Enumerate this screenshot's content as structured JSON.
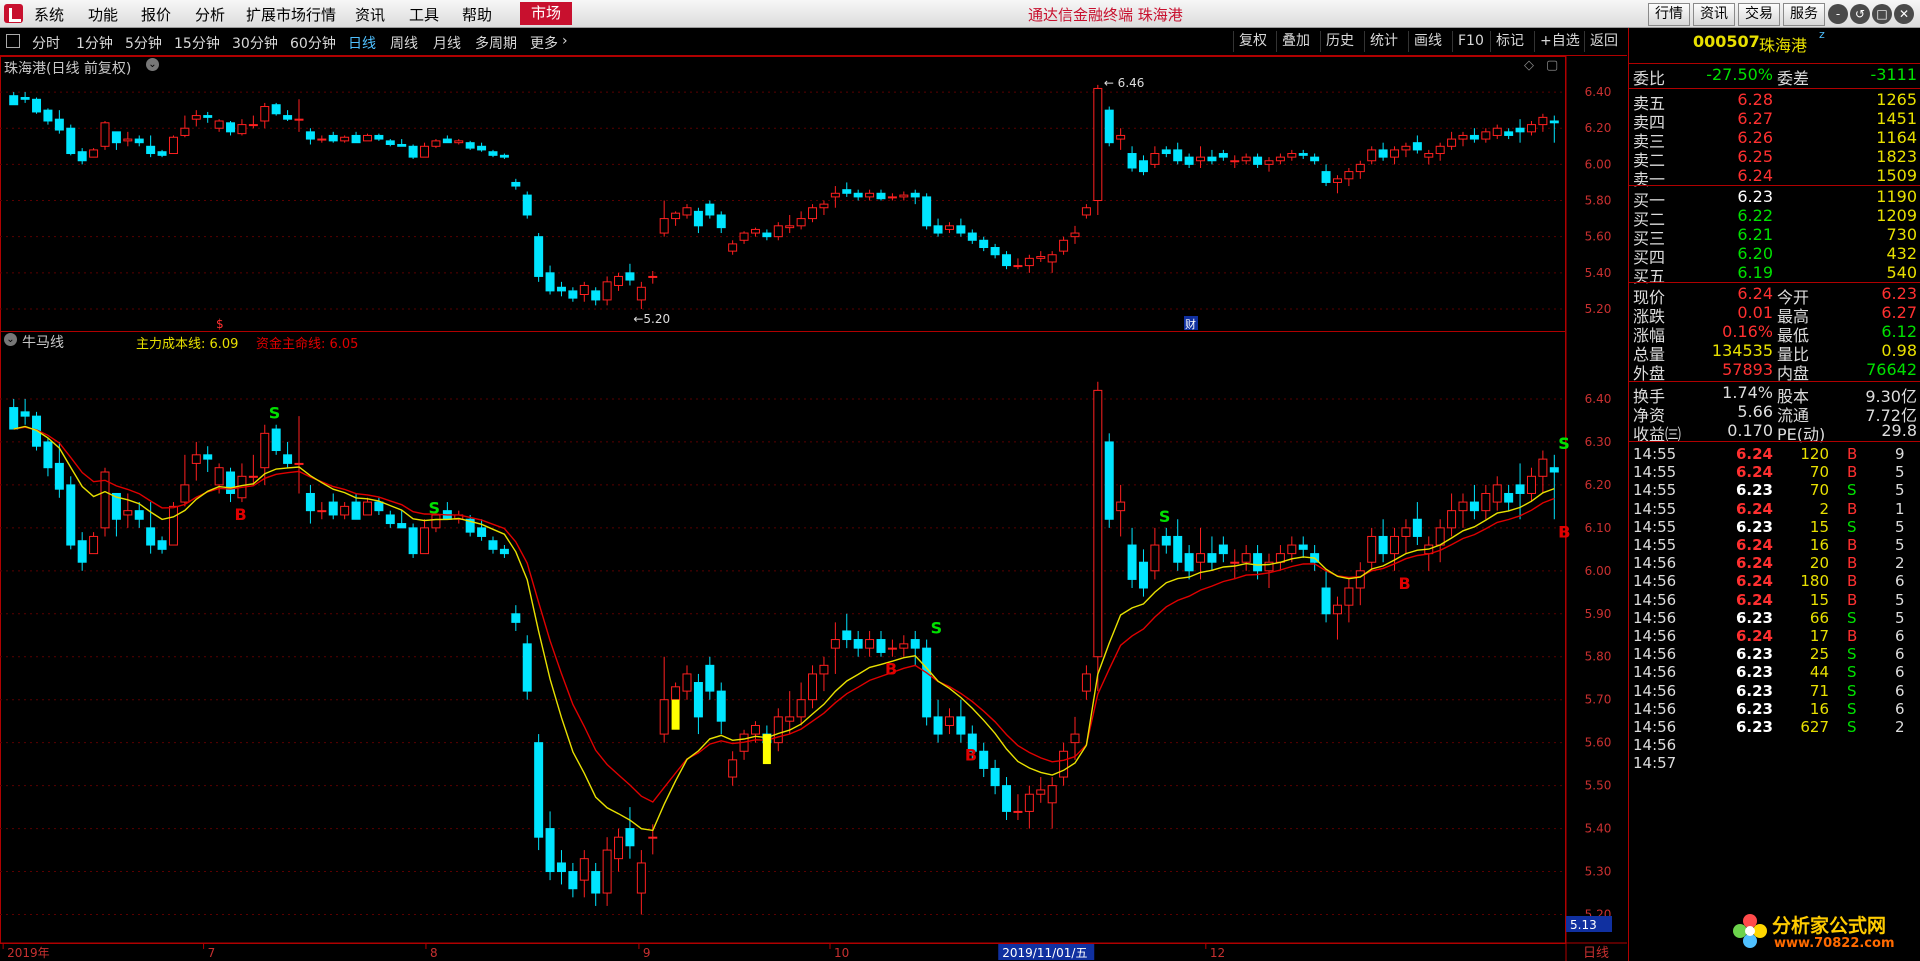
{
  "menubar": {
    "items": [
      "系统",
      "功能",
      "报价",
      "分析",
      "扩展市场行情",
      "资讯",
      "工具",
      "帮助"
    ],
    "market_button": "市场",
    "app_title": "通达信金融终端  珠海港",
    "right_buttons": [
      "行情",
      "资讯",
      "交易",
      "服务"
    ],
    "window_controls": [
      "-",
      "↺",
      "□",
      "✕"
    ]
  },
  "toolbar": {
    "periods": [
      "分时",
      "1分钟",
      "5分钟",
      "15分钟",
      "30分钟",
      "60分钟",
      "日线",
      "周线",
      "月线",
      "多周期",
      "更多"
    ],
    "active_period": "日线",
    "right_tools": [
      "复权",
      "叠加",
      "历史",
      "统计",
      "画线",
      "F10",
      "标记",
      "+自选",
      "返回"
    ]
  },
  "main_chart": {
    "title": "珠海港(日线 前复权)",
    "price_axis": [
      "6.40",
      "6.20",
      "6.00",
      "5.80",
      "5.60",
      "5.40",
      "5.20"
    ],
    "high_label": "6.46",
    "low_label": "5.20",
    "markers": {
      "dollar": "$",
      "finance": "财"
    }
  },
  "indicator_panel": {
    "name": "牛马线",
    "line1_label": "主力成本线: 6.09",
    "line2_label": "资金主命线: 6.05",
    "line1_color": "#e8e000",
    "line2_color": "#e00000",
    "price_axis": [
      "6.40",
      "6.30",
      "6.20",
      "6.10",
      "6.00",
      "5.90",
      "5.80",
      "5.70",
      "5.60",
      "5.50",
      "5.40",
      "5.30",
      "5.20"
    ],
    "current_price_tag": "5.13",
    "signal_buy": "B",
    "signal_sell": "S"
  },
  "time_axis": {
    "labels": [
      "2019年",
      "7",
      "8",
      "9",
      "10",
      "2019/11/01/五",
      "12"
    ],
    "period_label": "日线"
  },
  "chart_data": [
    {
      "type": "candlestick",
      "title": "珠海港(日线 前复权)",
      "ylim": [
        5.15,
        6.5
      ],
      "annotations": [
        {
          "label": "6.46",
          "kind": "high"
        },
        {
          "label": "5.20",
          "kind": "low"
        }
      ],
      "ohlc": [
        [
          6.38,
          6.4,
          6.33,
          6.33
        ],
        [
          6.37,
          6.4,
          6.34,
          6.36
        ],
        [
          6.36,
          6.37,
          6.28,
          6.29
        ],
        [
          6.3,
          6.31,
          6.22,
          6.24
        ],
        [
          6.25,
          6.3,
          6.17,
          6.19
        ],
        [
          6.2,
          6.22,
          6.05,
          6.06
        ],
        [
          6.07,
          6.09,
          6.0,
          6.02
        ],
        [
          6.04,
          6.09,
          6.04,
          6.08
        ],
        [
          6.1,
          6.24,
          6.08,
          6.23
        ],
        [
          6.18,
          6.18,
          6.08,
          6.12
        ],
        [
          6.13,
          6.18,
          6.1,
          6.14
        ],
        [
          6.14,
          6.16,
          6.1,
          6.12
        ],
        [
          6.1,
          6.16,
          6.04,
          6.06
        ],
        [
          6.07,
          6.08,
          6.04,
          6.05
        ],
        [
          6.06,
          6.16,
          6.06,
          6.15
        ],
        [
          6.16,
          6.27,
          6.15,
          6.2
        ],
        [
          6.25,
          6.3,
          6.21,
          6.27
        ],
        [
          6.27,
          6.29,
          6.23,
          6.26
        ],
        [
          6.2,
          6.25,
          6.18,
          6.24
        ],
        [
          6.23,
          6.24,
          6.16,
          6.18
        ],
        [
          6.17,
          6.25,
          6.16,
          6.22
        ],
        [
          6.22,
          6.27,
          6.2,
          6.22
        ],
        [
          6.24,
          6.34,
          6.2,
          6.32
        ],
        [
          6.33,
          6.34,
          6.27,
          6.28
        ],
        [
          6.27,
          6.3,
          6.24,
          6.25
        ],
        [
          6.25,
          6.36,
          6.18,
          6.25
        ],
        [
          6.18,
          6.2,
          6.11,
          6.14
        ],
        [
          6.14,
          6.16,
          6.12,
          6.14
        ],
        [
          6.16,
          6.18,
          6.12,
          6.13
        ],
        [
          6.13,
          6.16,
          6.12,
          6.15
        ],
        [
          6.16,
          6.18,
          6.12,
          6.12
        ],
        [
          6.13,
          6.17,
          6.13,
          6.16
        ],
        [
          6.16,
          6.17,
          6.13,
          6.14
        ],
        [
          6.13,
          6.14,
          6.1,
          6.11
        ],
        [
          6.11,
          6.14,
          6.1,
          6.1
        ],
        [
          6.1,
          6.11,
          6.03,
          6.04
        ],
        [
          6.04,
          6.12,
          6.04,
          6.1
        ],
        [
          6.1,
          6.14,
          6.09,
          6.13
        ],
        [
          6.14,
          6.16,
          6.12,
          6.12
        ],
        [
          6.12,
          6.14,
          6.11,
          6.13
        ],
        [
          6.12,
          6.13,
          6.08,
          6.09
        ],
        [
          6.1,
          6.12,
          6.07,
          6.08
        ],
        [
          6.07,
          6.08,
          6.04,
          6.05
        ],
        [
          6.05,
          6.06,
          6.03,
          6.04
        ],
        [
          5.9,
          5.92,
          5.86,
          5.88
        ],
        [
          5.83,
          5.85,
          5.7,
          5.72
        ],
        [
          5.6,
          5.62,
          5.35,
          5.38
        ],
        [
          5.4,
          5.44,
          5.28,
          5.3
        ],
        [
          5.32,
          5.35,
          5.27,
          5.3
        ],
        [
          5.3,
          5.32,
          5.24,
          5.26
        ],
        [
          5.28,
          5.35,
          5.24,
          5.33
        ],
        [
          5.3,
          5.32,
          5.22,
          5.25
        ],
        [
          5.25,
          5.38,
          5.22,
          5.35
        ],
        [
          5.33,
          5.4,
          5.3,
          5.38
        ],
        [
          5.4,
          5.45,
          5.33,
          5.36
        ],
        [
          5.25,
          5.35,
          5.2,
          5.32
        ],
        [
          5.38,
          5.41,
          5.34,
          5.38
        ],
        [
          5.62,
          5.8,
          5.6,
          5.7
        ],
        [
          5.7,
          5.74,
          5.66,
          5.73
        ],
        [
          5.72,
          5.78,
          5.7,
          5.76
        ],
        [
          5.74,
          5.76,
          5.62,
          5.66
        ],
        [
          5.78,
          5.8,
          5.7,
          5.72
        ],
        [
          5.72,
          5.74,
          5.62,
          5.65
        ],
        [
          5.52,
          5.58,
          5.5,
          5.56
        ],
        [
          5.58,
          5.63,
          5.56,
          5.62
        ],
        [
          5.62,
          5.65,
          5.6,
          5.64
        ],
        [
          5.62,
          5.64,
          5.58,
          5.6
        ],
        [
          5.6,
          5.68,
          5.58,
          5.66
        ],
        [
          5.65,
          5.72,
          5.62,
          5.66
        ],
        [
          5.66,
          5.74,
          5.64,
          5.7
        ],
        [
          5.7,
          5.78,
          5.68,
          5.76
        ],
        [
          5.76,
          5.8,
          5.72,
          5.78
        ],
        [
          5.82,
          5.88,
          5.76,
          5.84
        ],
        [
          5.86,
          5.9,
          5.82,
          5.84
        ],
        [
          5.84,
          5.86,
          5.8,
          5.82
        ],
        [
          5.82,
          5.86,
          5.8,
          5.84
        ],
        [
          5.84,
          5.86,
          5.8,
          5.81
        ],
        [
          5.82,
          5.84,
          5.8,
          5.82
        ],
        [
          5.82,
          5.85,
          5.8,
          5.83
        ],
        [
          5.84,
          5.86,
          5.78,
          5.82
        ],
        [
          5.82,
          5.84,
          5.64,
          5.66
        ],
        [
          5.66,
          5.7,
          5.6,
          5.62
        ],
        [
          5.64,
          5.68,
          5.62,
          5.66
        ],
        [
          5.66,
          5.7,
          5.6,
          5.62
        ],
        [
          5.62,
          5.64,
          5.56,
          5.58
        ],
        [
          5.58,
          5.6,
          5.52,
          5.54
        ],
        [
          5.54,
          5.56,
          5.48,
          5.5
        ],
        [
          5.5,
          5.52,
          5.42,
          5.44
        ],
        [
          5.44,
          5.48,
          5.42,
          5.44
        ],
        [
          5.44,
          5.5,
          5.4,
          5.48
        ],
        [
          5.48,
          5.52,
          5.46,
          5.49
        ],
        [
          5.46,
          5.52,
          5.4,
          5.5
        ],
        [
          5.52,
          5.6,
          5.5,
          5.58
        ],
        [
          5.6,
          5.66,
          5.56,
          5.62
        ],
        [
          5.72,
          5.78,
          5.7,
          5.76
        ],
        [
          5.8,
          6.44,
          5.72,
          6.42
        ],
        [
          6.3,
          6.32,
          6.1,
          6.12
        ],
        [
          6.14,
          6.2,
          6.08,
          6.16
        ],
        [
          6.06,
          6.1,
          5.96,
          5.98
        ],
        [
          6.02,
          6.05,
          5.94,
          5.96
        ],
        [
          6.0,
          6.1,
          5.98,
          6.06
        ],
        [
          6.08,
          6.1,
          6.04,
          6.06
        ],
        [
          6.08,
          6.12,
          6.0,
          6.02
        ],
        [
          6.04,
          6.06,
          5.98,
          6.0
        ],
        [
          6.02,
          6.1,
          5.98,
          6.04
        ],
        [
          6.04,
          6.08,
          6.0,
          6.02
        ],
        [
          6.06,
          6.08,
          6.02,
          6.04
        ],
        [
          6.02,
          6.05,
          5.98,
          6.02
        ],
        [
          6.02,
          6.06,
          6.0,
          6.04
        ],
        [
          6.04,
          6.06,
          5.98,
          6.0
        ],
        [
          6.0,
          6.04,
          5.96,
          6.02
        ],
        [
          6.02,
          6.06,
          6.0,
          6.04
        ],
        [
          6.04,
          6.08,
          6.02,
          6.06
        ],
        [
          6.06,
          6.08,
          6.03,
          6.05
        ],
        [
          6.04,
          6.06,
          6.0,
          6.02
        ],
        [
          5.96,
          6.0,
          5.88,
          5.9
        ],
        [
          5.9,
          5.94,
          5.84,
          5.92
        ],
        [
          5.92,
          5.98,
          5.88,
          5.96
        ],
        [
          5.96,
          6.02,
          5.92,
          6.0
        ],
        [
          6.02,
          6.1,
          6.0,
          6.08
        ],
        [
          6.08,
          6.12,
          6.02,
          6.04
        ],
        [
          6.04,
          6.1,
          6.0,
          6.08
        ],
        [
          6.08,
          6.12,
          6.04,
          6.1
        ],
        [
          6.12,
          6.16,
          6.06,
          6.08
        ],
        [
          6.04,
          6.08,
          6.0,
          6.06
        ],
        [
          6.06,
          6.12,
          6.02,
          6.1
        ],
        [
          6.1,
          6.18,
          6.08,
          6.14
        ],
        [
          6.14,
          6.18,
          6.1,
          6.16
        ],
        [
          6.16,
          6.2,
          6.12,
          6.14
        ],
        [
          6.14,
          6.2,
          6.12,
          6.18
        ],
        [
          6.16,
          6.22,
          6.14,
          6.2
        ],
        [
          6.18,
          6.2,
          6.14,
          6.16
        ],
        [
          6.2,
          6.25,
          6.12,
          6.18
        ],
        [
          6.18,
          6.24,
          6.16,
          6.22
        ],
        [
          6.22,
          6.28,
          6.18,
          6.26
        ],
        [
          6.24,
          6.27,
          6.12,
          6.23
        ]
      ]
    },
    {
      "type": "line",
      "title": "牛马线",
      "ylim": [
        5.15,
        6.5
      ],
      "series": [
        {
          "name": "主力成本线",
          "color": "#e8e000",
          "last": 6.09
        },
        {
          "name": "资金主命线",
          "color": "#e00000",
          "last": 6.05
        }
      ],
      "signals": [
        {
          "label": "S",
          "bar": 22
        },
        {
          "label": "B",
          "bar": 19
        },
        {
          "label": "S",
          "bar": 36
        },
        {
          "label": "B",
          "bar": 76
        },
        {
          "label": "S",
          "bar": 80
        },
        {
          "label": "B",
          "bar": 83
        },
        {
          "label": "S",
          "bar": 100
        },
        {
          "label": "B",
          "bar": 121
        },
        {
          "label": "S",
          "bar": 143
        },
        {
          "label": "B",
          "bar": 149
        },
        {
          "label": "S",
          "bar": 154
        },
        {
          "label": "B",
          "bar": 156
        }
      ]
    }
  ],
  "quote_panel": {
    "code": "000507",
    "name": "珠海港",
    "weibi_label": "委比",
    "weibi_value": "-27.50%",
    "weicha_label": "委差",
    "weicha_value": "-3111",
    "asks": [
      {
        "label": "卖五",
        "price": "6.28",
        "vol": "1265"
      },
      {
        "label": "卖四",
        "price": "6.27",
        "vol": "1451"
      },
      {
        "label": "卖三",
        "price": "6.26",
        "vol": "1164"
      },
      {
        "label": "卖二",
        "price": "6.25",
        "vol": "1823"
      },
      {
        "label": "卖一",
        "price": "6.24",
        "vol": "1509"
      }
    ],
    "bids": [
      {
        "label": "买一",
        "price": "6.23",
        "vol": "1190"
      },
      {
        "label": "买二",
        "price": "6.22",
        "vol": "1209"
      },
      {
        "label": "买三",
        "price": "6.21",
        "vol": "730"
      },
      {
        "label": "买四",
        "price": "6.20",
        "vol": "432"
      },
      {
        "label": "买五",
        "price": "6.19",
        "vol": "540"
      }
    ],
    "stats": [
      {
        "l1": "现价",
        "v1": "6.24",
        "l2": "今开",
        "v2": "6.23"
      },
      {
        "l1": "涨跌",
        "v1": "0.01",
        "l2": "最高",
        "v2": "6.27"
      },
      {
        "l1": "涨幅",
        "v1": "0.16%",
        "l2": "最低",
        "v2": "6.12"
      },
      {
        "l1": "总量",
        "v1": "134535",
        "l2": "量比",
        "v2": "0.98"
      },
      {
        "l1": "外盘",
        "v1": "57893",
        "l2": "内盘",
        "v2": "76642"
      }
    ],
    "fundamentals": [
      {
        "l1": "换手",
        "v1": "1.74%",
        "l2": "股本",
        "v2": "9.30亿"
      },
      {
        "l1": "净资",
        "v1": "5.66",
        "l2": "流通",
        "v2": "7.72亿"
      },
      {
        "l1": "收益㈢",
        "v1": "0.170",
        "l2": "PE(动)",
        "v2": "29.8"
      }
    ],
    "ticks": [
      {
        "time": "14:55",
        "price": "6.24",
        "vol": "120",
        "bs": "B",
        "n": "9"
      },
      {
        "time": "14:55",
        "price": "6.24",
        "vol": "70",
        "bs": "B",
        "n": "5"
      },
      {
        "time": "14:55",
        "price": "6.23",
        "vol": "70",
        "bs": "S",
        "n": "5"
      },
      {
        "time": "14:55",
        "price": "6.24",
        "vol": "2",
        "bs": "B",
        "n": "1"
      },
      {
        "time": "14:55",
        "price": "6.23",
        "vol": "15",
        "bs": "S",
        "n": "5"
      },
      {
        "time": "14:55",
        "price": "6.24",
        "vol": "16",
        "bs": "B",
        "n": "5"
      },
      {
        "time": "14:56",
        "price": "6.24",
        "vol": "20",
        "bs": "B",
        "n": "2"
      },
      {
        "time": "14:56",
        "price": "6.24",
        "vol": "180",
        "bs": "B",
        "n": "6"
      },
      {
        "time": "14:56",
        "price": "6.24",
        "vol": "15",
        "bs": "B",
        "n": "5"
      },
      {
        "time": "14:56",
        "price": "6.23",
        "vol": "66",
        "bs": "S",
        "n": "5"
      },
      {
        "time": "14:56",
        "price": "6.24",
        "vol": "17",
        "bs": "B",
        "n": "6"
      },
      {
        "time": "14:56",
        "price": "6.23",
        "vol": "25",
        "bs": "S",
        "n": "6"
      },
      {
        "time": "14:56",
        "price": "6.23",
        "vol": "44",
        "bs": "S",
        "n": "6"
      },
      {
        "time": "14:56",
        "price": "6.23",
        "vol": "71",
        "bs": "S",
        "n": "6"
      },
      {
        "time": "14:56",
        "price": "6.23",
        "vol": "16",
        "bs": "S",
        "n": "6"
      },
      {
        "time": "14:56",
        "price": "6.23",
        "vol": "627",
        "bs": "S",
        "n": "2"
      },
      {
        "time": "14:56",
        "price": "",
        "vol": "",
        "bs": "",
        "n": ""
      },
      {
        "time": "14:57",
        "price": "",
        "vol": "",
        "bs": "",
        "n": ""
      }
    ]
  },
  "watermark": {
    "line1": "分析家公式网",
    "line2": "www.70822.com"
  },
  "colors": {
    "up": "#ff2020",
    "down": "#00e5ff",
    "axis_red": "#b00000",
    "ma_yellow": "#e8e000",
    "signal_buy": "#e00000",
    "signal_sell": "#00e000"
  }
}
